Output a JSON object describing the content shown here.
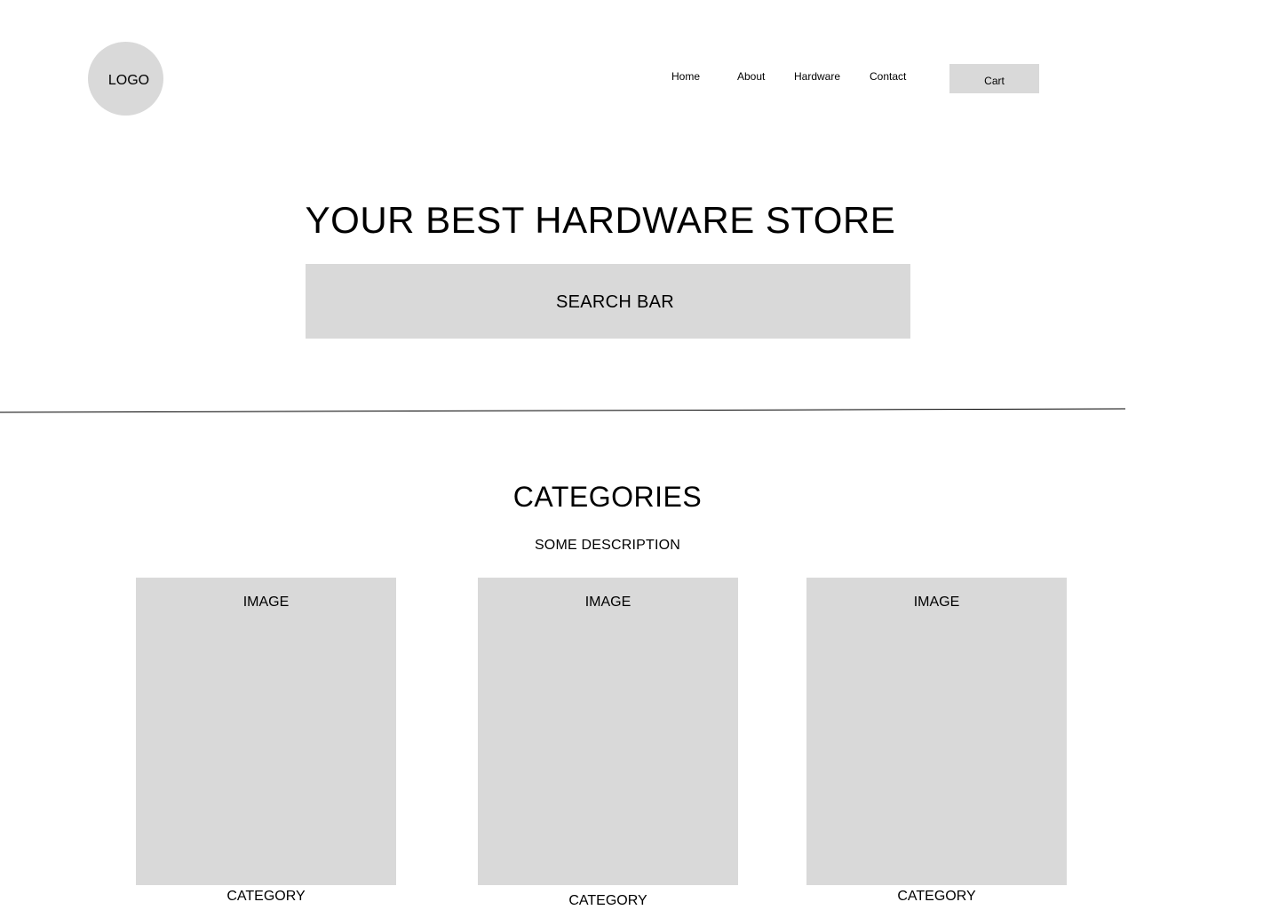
{
  "header": {
    "logo_text": "LOGO",
    "nav": {
      "home": "Home",
      "about": "About",
      "hardware": "Hardware",
      "contact": "Contact"
    },
    "cart_label": "Cart"
  },
  "hero": {
    "title": "YOUR BEST HARDWARE STORE",
    "search_label": "SEARCH BAR"
  },
  "categories": {
    "title": "CATEGORIES",
    "description": "SOME DESCRIPTION",
    "cards": [
      {
        "image_label": "IMAGE",
        "label": "CATEGORY"
      },
      {
        "image_label": "IMAGE",
        "label": "CATEGORY"
      },
      {
        "image_label": "IMAGE",
        "label": "CATEGORY"
      }
    ]
  },
  "colors": {
    "placeholder_fill": "#d9d9d9",
    "text": "#000000",
    "background": "#ffffff"
  }
}
